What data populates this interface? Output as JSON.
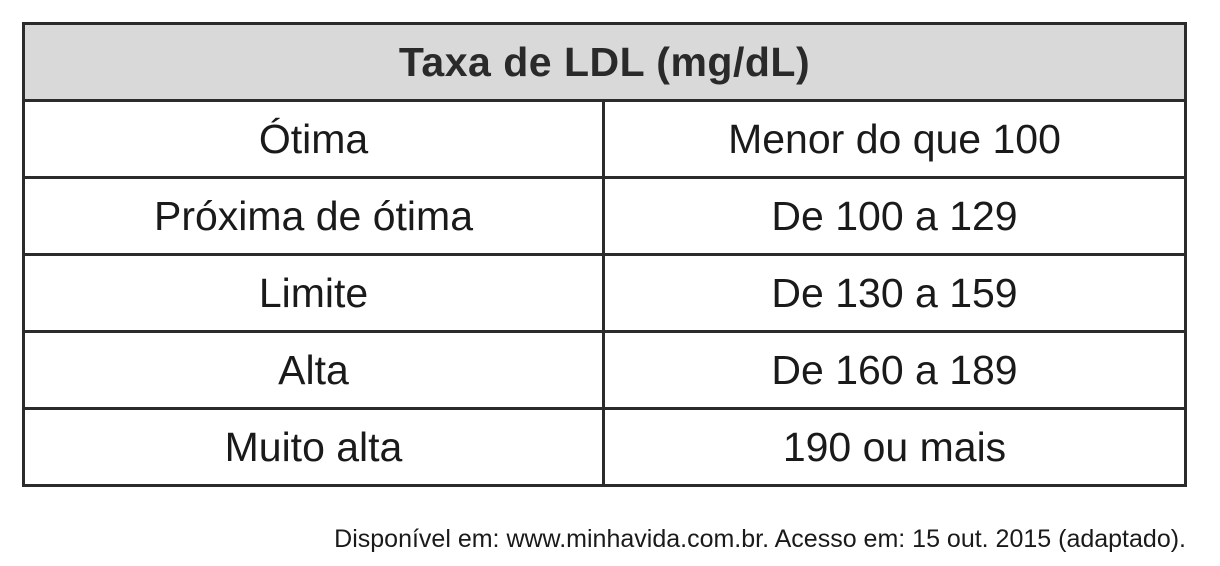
{
  "table": {
    "title": "Taxa de LDL (mg/dL)",
    "rows": [
      {
        "category": "Ótima",
        "range": "Menor do que 100"
      },
      {
        "category": "Próxima de ótima",
        "range": "De 100 a 129"
      },
      {
        "category": "Limite",
        "range": "De 130 a 159"
      },
      {
        "category": "Alta",
        "range": "De 160 a 189"
      },
      {
        "category": "Muito alta",
        "range": "190 ou mais"
      }
    ]
  },
  "source": "Disponível em: www.minhavida.com.br. Acesso em: 15 out. 2015 (adaptado)."
}
